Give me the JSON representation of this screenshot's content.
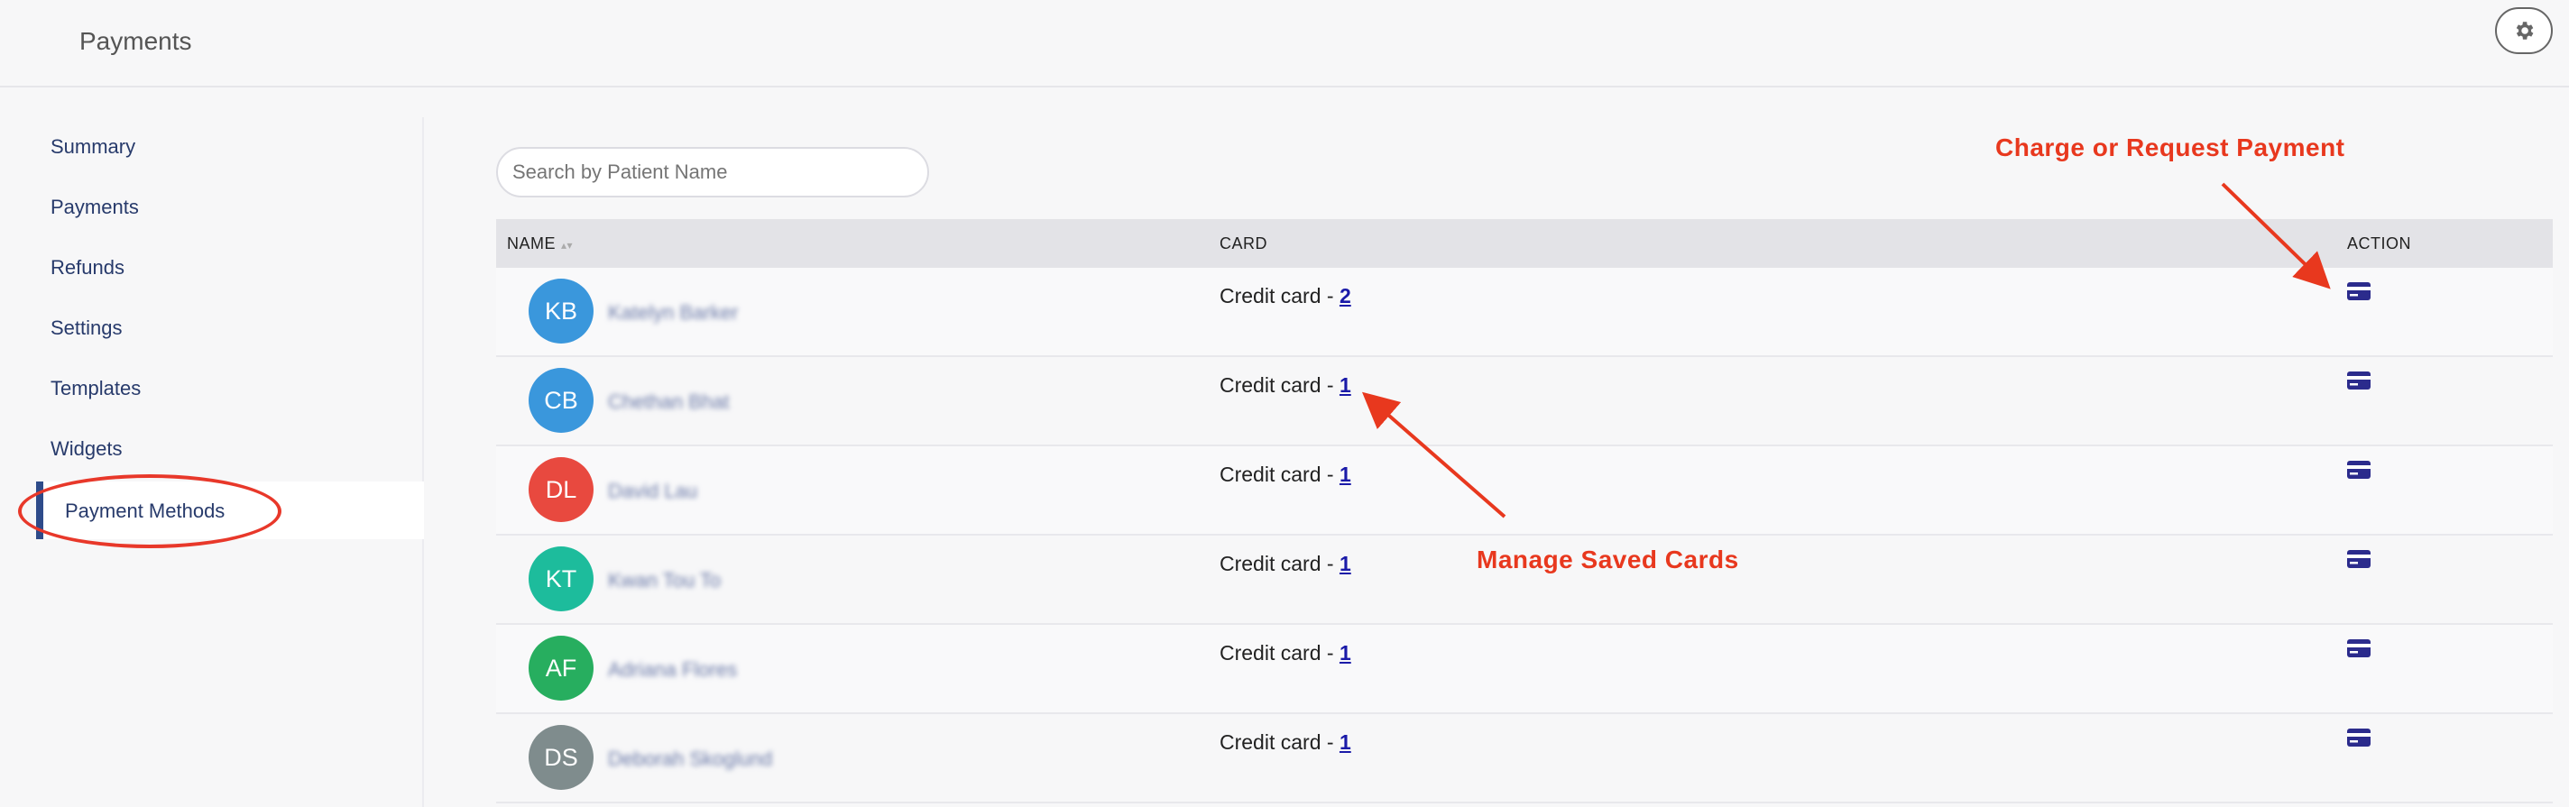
{
  "header": {
    "title": "Payments"
  },
  "sidebar": {
    "items": [
      {
        "label": "Summary"
      },
      {
        "label": "Payments"
      },
      {
        "label": "Refunds"
      },
      {
        "label": "Settings"
      },
      {
        "label": "Templates"
      },
      {
        "label": "Widgets"
      },
      {
        "label": "Payment Methods",
        "active": true
      }
    ]
  },
  "search": {
    "placeholder": "Search by Patient Name",
    "value": ""
  },
  "table": {
    "columns": {
      "name": "NAME",
      "card": "CARD",
      "action": "ACTION"
    },
    "rows": [
      {
        "initials": "KB",
        "name": "Katelyn Barker",
        "avatar_color": "#3a97dc",
        "card_label": "Credit card - ",
        "card_count": "2"
      },
      {
        "initials": "CB",
        "name": "Chethan Bhat",
        "avatar_color": "#3a97dc",
        "card_label": "Credit card - ",
        "card_count": "1"
      },
      {
        "initials": "DL",
        "name": "David Lau",
        "avatar_color": "#e8493f",
        "card_label": "Credit card - ",
        "card_count": "1"
      },
      {
        "initials": "KT",
        "name": "Kwan Tou To",
        "avatar_color": "#1dbc9c",
        "card_label": "Credit card - ",
        "card_count": "1"
      },
      {
        "initials": "AF",
        "name": "Adriana Flores",
        "avatar_color": "#27ae5f",
        "card_label": "Credit card - ",
        "card_count": "1"
      },
      {
        "initials": "DS",
        "name": "Deborah Skoglund",
        "avatar_color": "#7f8c8d",
        "card_label": "Credit card - ",
        "card_count": "1"
      }
    ]
  },
  "annotations": {
    "charge": "Charge or Request Payment",
    "manage": "Manage Saved Cards"
  },
  "colors": {
    "accent": "#273a6b",
    "annotation": "#e8381e",
    "action_icon": "#2b2b8c"
  },
  "icons": {
    "settings": "gear-icon",
    "action": "credit-card-icon"
  }
}
